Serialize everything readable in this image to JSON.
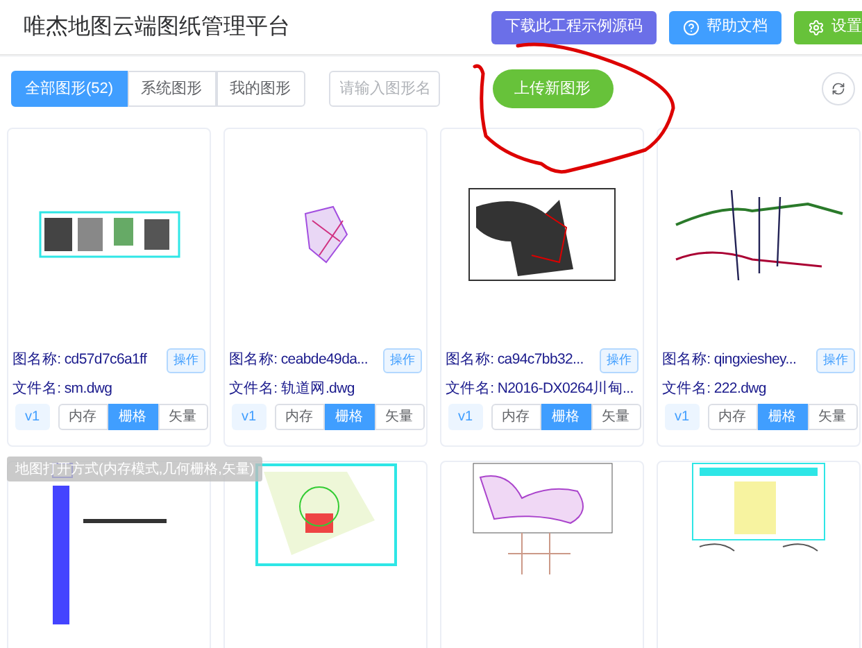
{
  "header": {
    "title": "唯杰地图云端图纸管理平台",
    "buttons": [
      {
        "label": "下载此工程示例源码",
        "kind": "download"
      },
      {
        "label": "帮助文档",
        "kind": "help"
      },
      {
        "label": "设置",
        "kind": "settings"
      }
    ]
  },
  "toolbar": {
    "tabs": [
      {
        "label": "全部图形(52)",
        "selected": true
      },
      {
        "label": "系统图形",
        "selected": false
      },
      {
        "label": "我的图形",
        "selected": false
      }
    ],
    "search": {
      "placeholder": "请输入图形名"
    },
    "upload_button": "上传新图形"
  },
  "cards": [
    {
      "name_label": "图名称:",
      "name": "cd57d7c6a1ff",
      "action": "操作",
      "file_label": "文件名:",
      "file": "sm.dwg",
      "version": "v1",
      "modes": [
        {
          "label": "内存",
          "selected": false
        },
        {
          "label": "栅格",
          "selected": true
        },
        {
          "label": "矢量",
          "selected": false
        }
      ]
    },
    {
      "name_label": "图名称:",
      "name": "ceabde49da...",
      "action": "操作",
      "file_label": "文件名:",
      "file": "轨道网.dwg",
      "version": "v1",
      "modes": [
        {
          "label": "内存",
          "selected": false
        },
        {
          "label": "栅格",
          "selected": true
        },
        {
          "label": "矢量",
          "selected": false
        }
      ]
    },
    {
      "name_label": "图名称:",
      "name": "ca94c7bb32...",
      "action": "操作",
      "file_label": "文件名:",
      "file": "N2016-DX0264川甸...",
      "version": "v1",
      "modes": [
        {
          "label": "内存",
          "selected": false
        },
        {
          "label": "栅格",
          "selected": true
        },
        {
          "label": "矢量",
          "selected": false
        }
      ]
    },
    {
      "name_label": "图名称:",
      "name": "qingxieshey...",
      "action": "操作",
      "file_label": "文件名:",
      "file": "222.dwg",
      "version": "v1",
      "modes": [
        {
          "label": "内存",
          "selected": false
        },
        {
          "label": "栅格",
          "selected": true
        },
        {
          "label": "矢量",
          "selected": false
        }
      ]
    },
    {
      "kind": "picture"
    },
    {
      "kind": "picture"
    },
    {
      "kind": "picture"
    },
    {
      "kind": "picture"
    }
  ],
  "tooltip": "地图打开方式(内存模式,几何栅格,矢量)"
}
